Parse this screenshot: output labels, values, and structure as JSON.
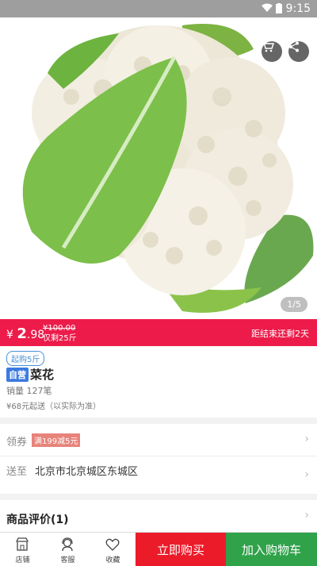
{
  "status_bar": {
    "time": "9:15"
  },
  "gallery": {
    "counter": "1/5"
  },
  "price_bar": {
    "currency": "¥",
    "price_int": "2",
    "price_dec": ".98",
    "original_price": "¥100.00",
    "remaining": "仅剩25斤",
    "countdown": "距结束还剩2天"
  },
  "product": {
    "min_purchase": "起购5斤",
    "self_tag": "自营",
    "name": "菜花",
    "sales": "销量 127笔",
    "shipping": "¥68元起送（以实际为准）"
  },
  "coupon": {
    "label": "领券",
    "badge": "满199减5元"
  },
  "delivery": {
    "label": "送至",
    "address": "北京市北京城区东城区"
  },
  "reviews": {
    "title": "商品评价(1)"
  },
  "bottom_bar": {
    "store": "店铺",
    "service": "客服",
    "favorite": "收藏",
    "buy_now": "立即购买",
    "add_cart": "加入购物车"
  },
  "colors": {
    "accent": "#ec1b4a",
    "buy": "#ec1b2a",
    "cart": "#2fa24a"
  }
}
